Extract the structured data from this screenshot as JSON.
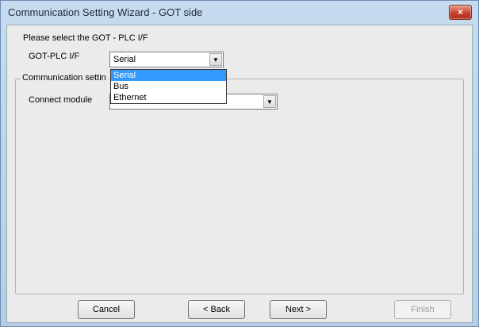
{
  "window": {
    "title": "Communication Setting Wizard - GOT side",
    "close_glyph": "×"
  },
  "form": {
    "prompt": "Please select the GOT - PLC I/F",
    "got_plc_if_label": "GOT-PLC I/F",
    "got_plc_if_value": "Serial",
    "group_label": "Communication settin",
    "connect_module_label": "Connect module",
    "connect_module_value": ""
  },
  "dropdown": {
    "options": [
      "Serial",
      "Bus",
      "Ethernet"
    ],
    "selected": "Serial"
  },
  "buttons": {
    "cancel": "Cancel",
    "back": "< Back",
    "next": "Next >",
    "finish": "Finish"
  },
  "icons": {
    "close": "close-icon",
    "dropdown_arrow": "chevron-down-icon"
  },
  "colors": {
    "highlight": "#3399ff",
    "close_button": "#c5402b"
  }
}
